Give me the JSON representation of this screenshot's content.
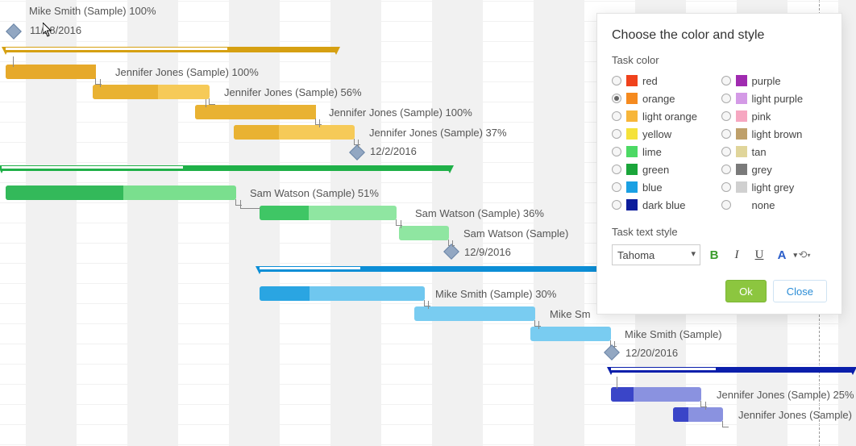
{
  "gantt": {
    "tasks": [
      {
        "name": "Mike Smith (Sample)",
        "percent": "100%",
        "label": "Mike Smith (Sample)  100%"
      },
      {
        "name": "Jennifer Jones (Sample)",
        "percent": "100%",
        "label": "Jennifer Jones (Sample)  100%"
      },
      {
        "name": "Jennifer Jones (Sample)",
        "percent": "56%",
        "label": "Jennifer Jones (Sample)  56%"
      },
      {
        "name": "Jennifer Jones (Sample)",
        "percent": "100%",
        "label": "Jennifer Jones (Sample)  100%"
      },
      {
        "name": "Jennifer Jones (Sample)",
        "percent": "37%",
        "label": "Jennifer Jones (Sample)  37%"
      },
      {
        "name": "Sam Watson (Sample)",
        "percent": "51%",
        "label": "Sam Watson (Sample)  51%"
      },
      {
        "name": "Sam Watson (Sample)",
        "percent": "36%",
        "label": "Sam Watson (Sample)  36%"
      },
      {
        "name": "Sam Watson (Sample)",
        "percent": "",
        "label": "Sam Watson (Sample)"
      },
      {
        "name": "Mike Smith (Sample)",
        "percent": "30%",
        "label": "Mike Smith (Sample)  30%"
      },
      {
        "name": "Mike Sm",
        "percent": "",
        "label": "Mike Sm"
      },
      {
        "name": "Mike Smith (Sample)",
        "percent": "",
        "label": "Mike Smith (Sample)"
      },
      {
        "name": "Jennifer Jones (Sample)",
        "percent": "25%",
        "label": "Jennifer Jones (Sample)  25%"
      },
      {
        "name": "Jennifer Jones (Sample)",
        "percent": "",
        "label": "Jennifer Jones (Sample)"
      }
    ],
    "milestones": [
      {
        "date": "11/18/2016",
        "label": "11/18/2016"
      },
      {
        "date": "12/2/2016",
        "label": "12/2/2016"
      },
      {
        "date": "12/9/2016",
        "label": "12/9/2016"
      },
      {
        "date": "12/20/2016",
        "label": "12/20/2016"
      }
    ]
  },
  "panel": {
    "title": "Choose the color and style",
    "colorLabel": "Task color",
    "colors_left": [
      {
        "label": "red",
        "hex": "#f0421c",
        "selected": false
      },
      {
        "label": "orange",
        "hex": "#f58a1f",
        "selected": true
      },
      {
        "label": "light orange",
        "hex": "#f7b63a",
        "selected": false
      },
      {
        "label": "yellow",
        "hex": "#f5e23a",
        "selected": false
      },
      {
        "label": "lime",
        "hex": "#4cd964",
        "selected": false
      },
      {
        "label": "green",
        "hex": "#1aa53a",
        "selected": false
      },
      {
        "label": "blue",
        "hex": "#1aa0e3",
        "selected": false
      },
      {
        "label": "dark blue",
        "hex": "#0c1d9c",
        "selected": false
      }
    ],
    "colors_right": [
      {
        "label": "purple",
        "hex": "#a02bb0",
        "selected": false
      },
      {
        "label": "light purple",
        "hex": "#d49ae6",
        "selected": false
      },
      {
        "label": "pink",
        "hex": "#f6a7c1",
        "selected": false
      },
      {
        "label": "light brown",
        "hex": "#bfa06a",
        "selected": false
      },
      {
        "label": "tan",
        "hex": "#e0d59a",
        "selected": false
      },
      {
        "label": "grey",
        "hex": "#7a7a7a",
        "selected": false
      },
      {
        "label": "light grey",
        "hex": "#d0d0d0",
        "selected": false
      },
      {
        "label": "none",
        "hex": "",
        "selected": false
      }
    ],
    "textStyleLabel": "Task text style",
    "fontName": "Tahoma",
    "buttons": {
      "ok": "Ok",
      "close": "Close"
    },
    "formatIcons": {
      "bold": "B",
      "italic": "I",
      "underline": "U",
      "fontcolor": "A",
      "chain": "⋄"
    }
  }
}
